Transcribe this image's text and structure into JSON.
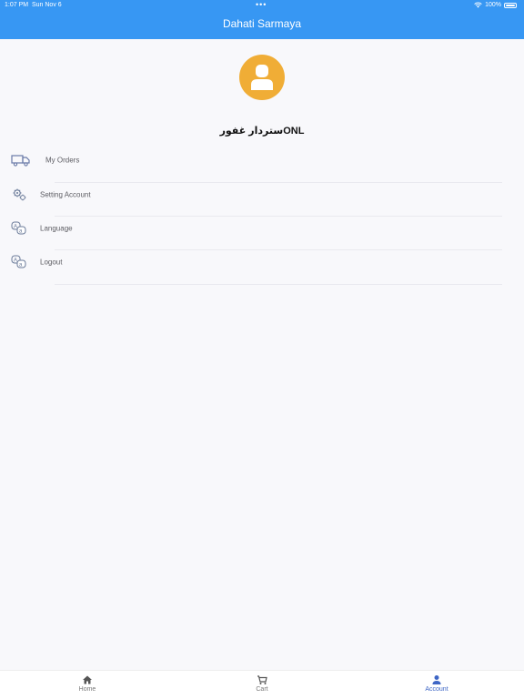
{
  "status": {
    "time": "1:07 PM",
    "date": "Sun Nov 6",
    "battery": "100%"
  },
  "header": {
    "title": "Dahati Sarmaya",
    "bg_color": "#3797f3"
  },
  "profile": {
    "name": "ستردار غفورONL",
    "avatar_color": "#f0ad36",
    "avatar_icon": "user-icon"
  },
  "menu": [
    {
      "label": "My Orders",
      "icon": "truck-icon"
    },
    {
      "label": "Setting Account",
      "icon": "gears-icon"
    },
    {
      "label": "Language",
      "icon": "translate-icon"
    },
    {
      "label": "Logout",
      "icon": "translate-icon"
    }
  ],
  "nav": {
    "tabs": [
      {
        "label": "Home",
        "icon": "home-icon"
      },
      {
        "label": "Cart",
        "icon": "cart-icon"
      },
      {
        "label": "Account",
        "icon": "person-icon",
        "active": true
      }
    ],
    "active_color": "#3e66c5"
  }
}
